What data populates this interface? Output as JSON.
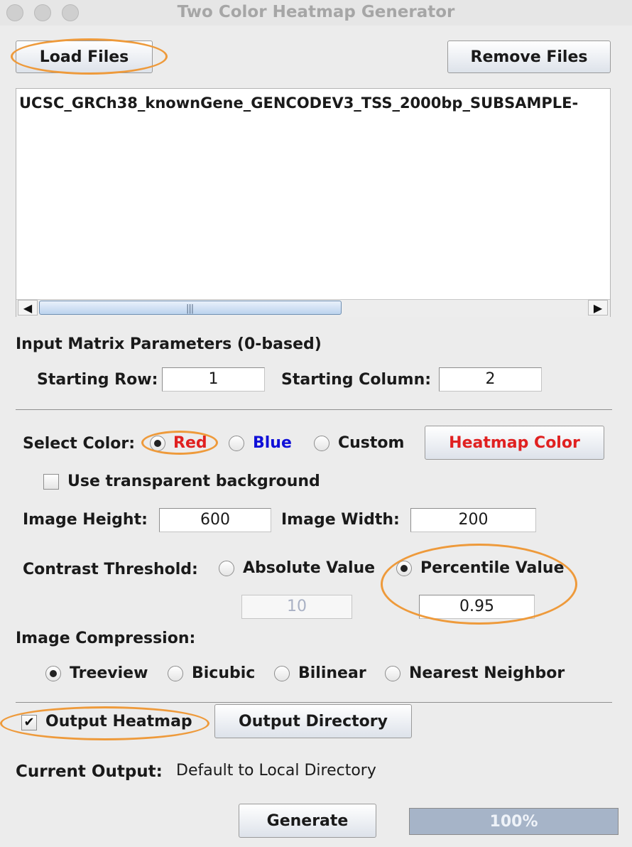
{
  "window": {
    "title": "Two Color Heatmap Generator"
  },
  "file_buttons": {
    "load": "Load Files",
    "remove": "Remove Files"
  },
  "file_list": {
    "items": [
      "UCSC_GRCh38_knownGene_GENCODEV3_TSS_2000bp_SUBSAMPLE-"
    ]
  },
  "matrix": {
    "heading": "Input Matrix Parameters (0-based)",
    "starting_row_label": "Starting Row:",
    "starting_row": "1",
    "starting_column_label": "Starting Column:",
    "starting_column": "2"
  },
  "color": {
    "label": "Select Color:",
    "options": [
      "Red",
      "Blue",
      "Custom"
    ],
    "selected": "Red",
    "option_colors": {
      "Red": "#e02020",
      "Blue": "#1010d8",
      "Custom": "#111111"
    },
    "heatmap_button": "Heatmap Color",
    "heatmap_button_color": "#e02020"
  },
  "transparent": {
    "label": "Use transparent background",
    "checked": false
  },
  "size": {
    "height_label": "Image Height:",
    "height": "600",
    "width_label": "Image Width:",
    "width": "200"
  },
  "contrast": {
    "label": "Contrast Threshold:",
    "absolute_label": "Absolute Value",
    "absolute_value": "10",
    "percentile_label": "Percentile Value",
    "percentile_value": "0.95",
    "selected": "Percentile Value"
  },
  "compression": {
    "heading": "Image Compression:",
    "options": [
      "Treeview",
      "Bicubic",
      "Bilinear",
      "Nearest Neighbor"
    ],
    "selected": "Treeview"
  },
  "output": {
    "heatmap_label": "Output Heatmap",
    "heatmap_checked": true,
    "directory_button": "Output Directory",
    "current_label": "Current Output:",
    "current_value": "Default to Local Directory"
  },
  "generate": {
    "button": "Generate",
    "progress": 1.0,
    "progress_text": "100%"
  },
  "accent": {
    "highlight": "#ee9a3b"
  }
}
